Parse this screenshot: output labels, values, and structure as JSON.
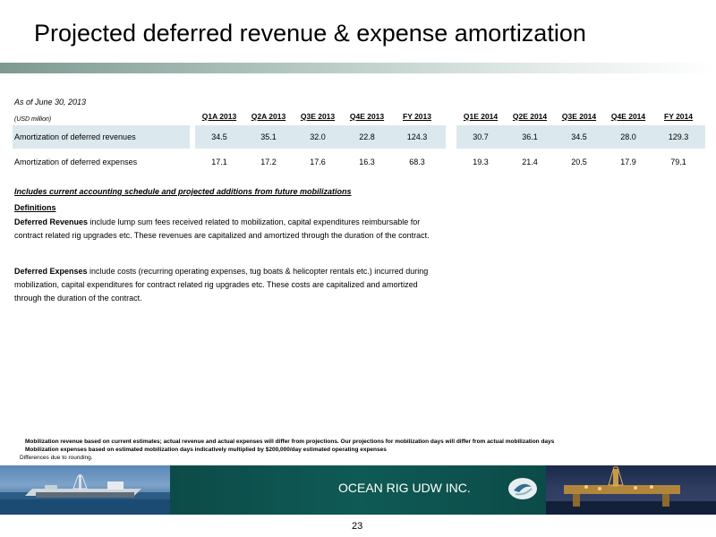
{
  "title": "Projected deferred revenue & expense amortization",
  "as_of": "As of June 30, 2013",
  "units": "(USD million)",
  "columns": [
    "Q1A 2013",
    "Q2A 2013",
    "Q3E 2013",
    "Q4E 2013",
    "FY 2013",
    "Q1E 2014",
    "Q2E 2014",
    "Q3E 2014",
    "Q4E 2014",
    "FY 2014"
  ],
  "rows": [
    {
      "label": "Amortization of deferred revenues",
      "values": [
        "34.5",
        "35.1",
        "32.0",
        "22.8",
        "124.3",
        "30.7",
        "36.1",
        "34.5",
        "28.0",
        "129.3"
      ]
    },
    {
      "label": "Amortization of deferred expenses",
      "values": [
        "17.1",
        "17.2",
        "17.6",
        "16.3",
        "68.3",
        "19.3",
        "21.4",
        "20.5",
        "17.9",
        "79.1"
      ]
    }
  ],
  "note": "Includes current accounting schedule and projected additions from future mobilizations",
  "definitions": {
    "heading": "Definitions",
    "revenues": {
      "term": "Deferred Revenues",
      "line1": " include lump sum fees received related to mobilization, capital expenditures reimbursable for",
      "line2": "contract related rig upgrades etc.  These revenues are capitalized and amortized through the duration of the contract."
    },
    "expenses": {
      "term": "Deferred Expenses",
      "line1": " include costs (recurring operating expenses, tug boats & helicopter rentals etc.)  incurred during",
      "line2": "mobilization, capital expenditures for contract related rig upgrades etc.  These costs are capitalized and amortized",
      "line3": "through the duration of the contract."
    }
  },
  "footnotes": {
    "line1": "Mobilization revenue based on current estimates; actual revenue and actual expenses will differ from projections. Our projections for mobilization days will differ from actual mobilization days",
    "line2": "Mobilization expenses based on estimated  mobilization days indicatively  multiplied by $200,000/day estimated operating expenses",
    "line3": "Differences due to rounding."
  },
  "brand": "OCEAN RIG UDW INC.",
  "page_number": "23",
  "colors": {
    "row_band": "#dbe9ee",
    "banner": "#0d4a46",
    "title_bar": "#7c9a91"
  }
}
